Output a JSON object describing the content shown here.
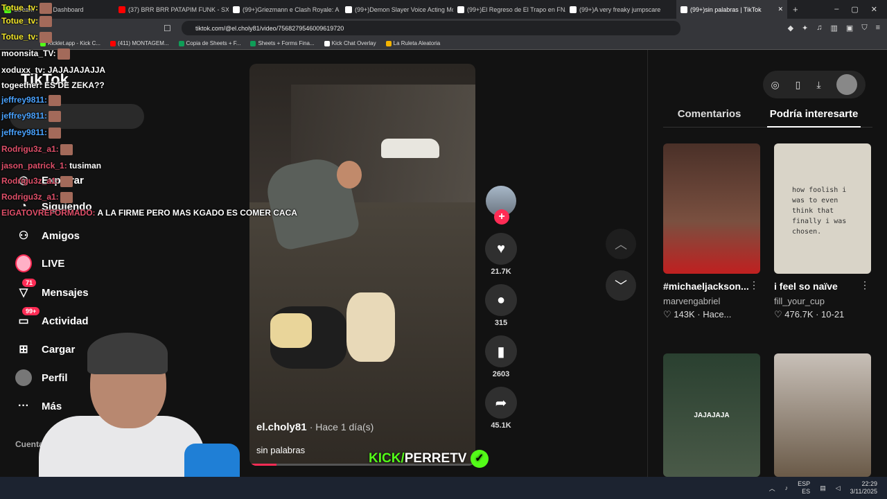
{
  "browser": {
    "tabs": [
      {
        "label": "Stream - Kick Dashboard",
        "icon": "kick-icon",
        "color": "#53fc18"
      },
      {
        "label": "(37) BRR BRR PATAPIM FUNK - SXYG",
        "icon": "youtube-icon",
        "color": "#ff0000"
      },
      {
        "label": "(99+)Griezmann e Clash Royale: A E",
        "icon": "tiktok-icon",
        "color": "#ffffff"
      },
      {
        "label": "(99+)Demon Slayer Voice Acting Mo",
        "icon": "tiktok-icon",
        "color": "#ffffff"
      },
      {
        "label": "(99+)El Regreso de El Trapo en FNAF",
        "icon": "tiktok-icon",
        "color": "#ffffff"
      },
      {
        "label": "(99+)A very freaky jumpscare",
        "icon": "tiktok-icon",
        "color": "#ffffff"
      },
      {
        "label": "(99+)sin palabras | TikTok",
        "icon": "tiktok-icon",
        "color": "#ffffff",
        "active": true
      }
    ],
    "url": "tiktok.com/@el.choly81/video/7568279546009619720",
    "bookmarks": [
      {
        "label": "Kicklet.app - Kick C...",
        "color": "#53fc18"
      },
      {
        "label": "(411) MONTAGEM...",
        "color": "#ff0000"
      },
      {
        "label": "Copia de Sheets + F...",
        "color": "#0f9d58"
      },
      {
        "label": "Sheets + Forms Fina...",
        "color": "#0f9d58"
      },
      {
        "label": "Kick Chat Overlay",
        "color": "#ffffff"
      },
      {
        "label": "La Ruleta Aleatoria",
        "color": "#f4b400"
      }
    ]
  },
  "tiktok": {
    "logo": "TikTok",
    "nav": [
      {
        "label": "Explorar",
        "icon": "compass-icon"
      },
      {
        "label": "Siguiendo",
        "icon": "following-icon"
      },
      {
        "label": "Amigos",
        "icon": "friends-icon"
      },
      {
        "label": "LIVE",
        "icon": "live-icon"
      },
      {
        "label": "Mensajes",
        "icon": "messages-icon",
        "badge": "71"
      },
      {
        "label": "Actividad",
        "icon": "activity-icon",
        "badge": "99+"
      },
      {
        "label": "Cargar",
        "icon": "upload-icon"
      },
      {
        "label": "Perfil",
        "icon": "profile-icon"
      },
      {
        "label": "Más",
        "icon": "more-icon"
      }
    ],
    "following_label": "Cuentas qu",
    "video": {
      "author": "el.choly81",
      "time": "· Hace 1 día(s)",
      "caption": "sin palabras",
      "progress": 0.12
    },
    "actions": {
      "likes": "21.7K",
      "comments": "315",
      "saves": "2603",
      "shares": "45.1K"
    },
    "right": {
      "tabs": [
        "Comentarios",
        "Podría interesarte"
      ],
      "cards": [
        {
          "title": "#michaeljackson...",
          "author": "marvengabriel",
          "meta": "143K · Hace...",
          "thumb": "#5a3a30"
        },
        {
          "title": "i feel so naïve",
          "author": "fill_your_cup",
          "meta": "476.7K · 10-21",
          "thumb": "#d9d4c8",
          "note": "how foolish i was to even think that finally i was chosen."
        },
        {
          "title": "",
          "author": "",
          "meta": "",
          "thumb": "#3a4a3a",
          "overlay": "JAJAJAJA"
        },
        {
          "title": "",
          "author": "",
          "meta": "",
          "thumb": "#6a5a48"
        }
      ]
    }
  },
  "chat": [
    {
      "user": "Totue_tv:",
      "msg": "",
      "color": "#f2e62a"
    },
    {
      "user": "Totue_tv:",
      "msg": "",
      "color": "#f2e62a"
    },
    {
      "user": "Totue_tv:",
      "msg": "",
      "color": "#f2e62a"
    },
    {
      "user": "moonsita_TV:",
      "msg": "",
      "color": "#ffffff"
    },
    {
      "user": "xoduxx_tv:",
      "msg": "JAJAJAJAJJA",
      "color": "#ffffff"
    },
    {
      "user": "togeether:",
      "msg": "ES DE ZEKA??",
      "color": "#ffffff"
    },
    {
      "user": "jeffrey9811:",
      "msg": "",
      "color": "#4aa3ff"
    },
    {
      "user": "jeffrey9811:",
      "msg": "",
      "color": "#4aa3ff"
    },
    {
      "user": "jeffrey9811:",
      "msg": "",
      "color": "#4aa3ff"
    },
    {
      "user": "Rodrigu3z_a1:",
      "msg": "",
      "color": "#e0506a"
    },
    {
      "user": "jason_patrick_1:",
      "msg": "tusiman",
      "color": "#e0506a"
    },
    {
      "user": "Rodrigu3z_a1:",
      "msg": "",
      "color": "#e0506a"
    },
    {
      "user": "Rodrigu3z_a1:",
      "msg": "",
      "color": "#e0506a"
    },
    {
      "user": "ElGATOVREFORMADO:",
      "msg": "A LA FIRME PERO MAS KGADO ES COMER CACA",
      "color": "#e0506a"
    }
  ],
  "overlay": {
    "kick_prefix": "KICK/",
    "channel": "PERRETV"
  },
  "taskbar": {
    "lang_top": "ESP",
    "lang_bottom": "ES",
    "time": "22:29",
    "date": "3/11/2025"
  }
}
